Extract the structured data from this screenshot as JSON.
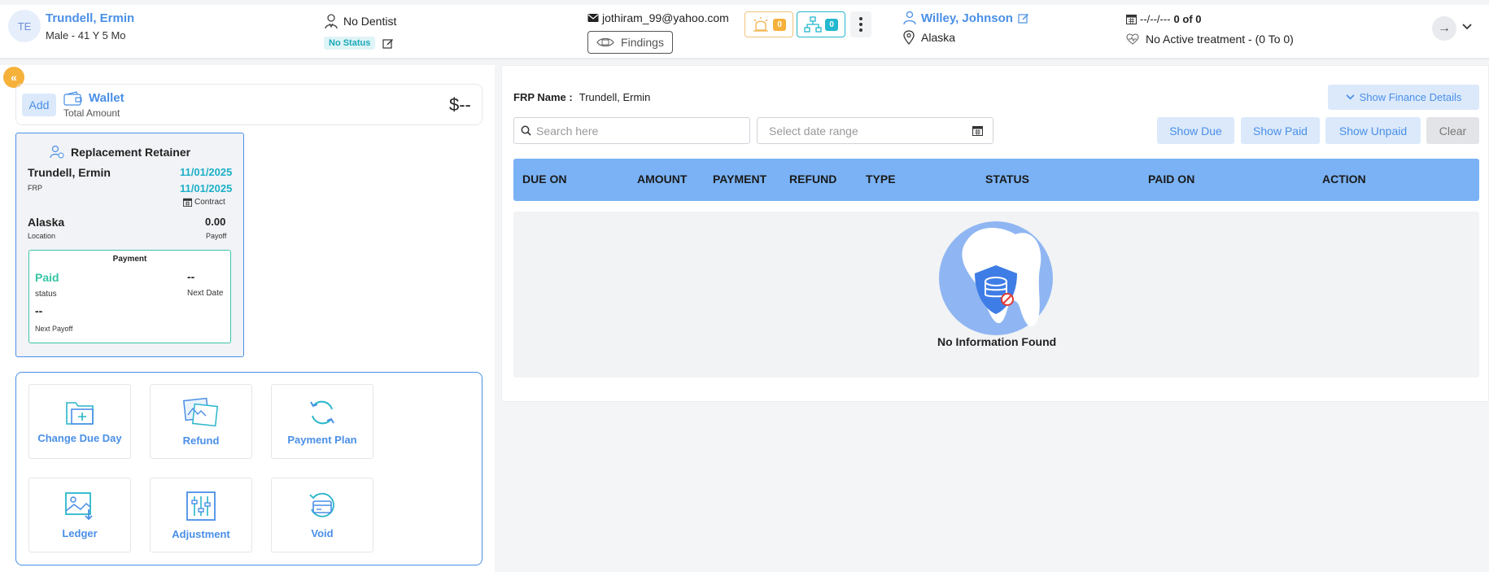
{
  "header": {
    "avatar_initials": "TE",
    "patient_name": "Trundell, Ermin",
    "patient_demo": "Male - 41 Y 5 Mo",
    "dentist": "No Dentist",
    "status": "No Status",
    "email": "jothiram_99@yahoo.com",
    "findings_label": "Findings",
    "alerts_count": "0",
    "relations_count": "0",
    "doctor_name": "Willey, Johnson",
    "location": "Alaska",
    "appointment_date": "--/--/---",
    "appointment_count": "0 of 0",
    "treatment": "No Active treatment - (0 To 0)"
  },
  "wallet": {
    "add_label": "Add",
    "title": "Wallet",
    "subtitle": "Total Amount",
    "amount": "$--"
  },
  "contract_card": {
    "title": "Replacement Retainer",
    "name": "Trundell, Ermin",
    "name_label": "FRP",
    "date1": "11/01/2025",
    "date2": "11/01/2025",
    "contract_label": "Contract",
    "location": "Alaska",
    "location_label": "Location",
    "payoff": "0.00",
    "payoff_label": "Payoff",
    "payment": {
      "title": "Payment",
      "status": "Paid",
      "status_label": "status",
      "next_date": "--",
      "next_date_label": "Next Date",
      "next_payoff": "--",
      "next_payoff_label": "Next Payoff"
    }
  },
  "actions": {
    "change_due_day": "Change Due Day",
    "refund": "Refund",
    "payment_plan": "Payment Plan",
    "ledger": "Ledger",
    "adjustment": "Adjustment",
    "void": "Void"
  },
  "main": {
    "frp_label": "FRP Name :",
    "frp_value": "Trundell, Ermin",
    "finance_button": "Show Finance Details",
    "search_placeholder": "Search here",
    "date_placeholder": "Select date range",
    "show_due": "Show Due",
    "show_paid": "Show Paid",
    "show_unpaid": "Show Unpaid",
    "clear": "Clear",
    "columns": [
      "DUE ON",
      "AMOUNT",
      "PAYMENT",
      "REFUND",
      "TYPE",
      "STATUS",
      "PAID ON",
      "ACTION"
    ],
    "empty_text": "No Information Found"
  },
  "colors": {
    "accent": "#4a8fe7",
    "teal": "#1cb0c8",
    "paid_green": "#35c4a4",
    "table_header": "#7ab2f5",
    "alert_orange": "#f6b13a"
  }
}
